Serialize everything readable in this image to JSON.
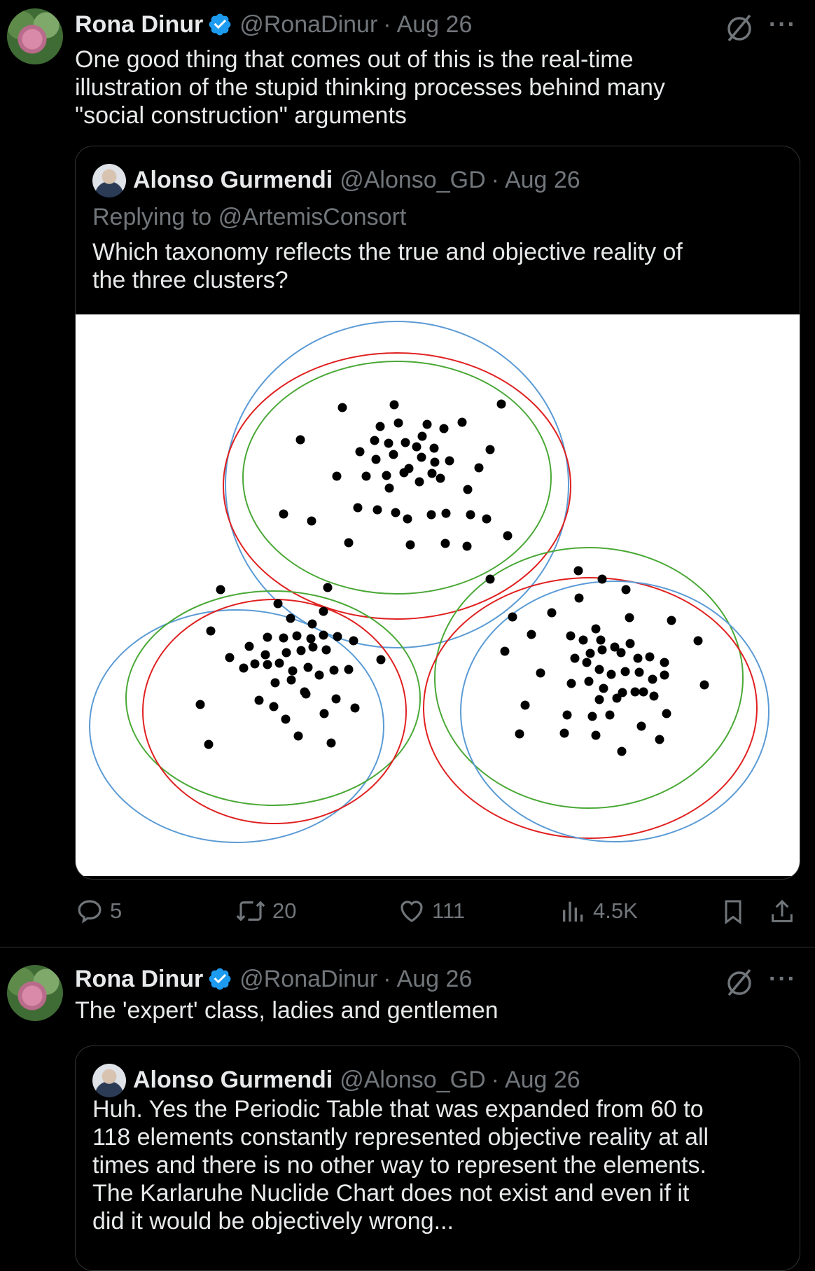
{
  "tweets": [
    {
      "author": "Rona Dinur",
      "handle": "@RonaDinur",
      "time": "Aug 26",
      "text_lines": [
        "One good thing that comes out of this is the real-time",
        "illustration of the stupid thinking processes behind many",
        "\"social construction\" arguments"
      ],
      "quote": {
        "author": "Alonso Gurmendi",
        "handle": "@Alonso_GD",
        "time": "Aug 26",
        "replying_prefix": "Replying to",
        "replying_to": "@ArtemisConsort",
        "text_lines": [
          "Which taxonomy reflects the true and objective reality of",
          "the three clusters?"
        ]
      },
      "actions": {
        "replies": "5",
        "reposts": "20",
        "likes": "111",
        "views": "4.5K"
      }
    },
    {
      "author": "Rona Dinur",
      "handle": "@RonaDinur",
      "time": "Aug 26",
      "text_lines": [
        "The 'expert' class, ladies and gentlemen"
      ],
      "quote": {
        "author": "Alonso Gurmendi",
        "handle": "@Alonso_GD",
        "time": "Aug 26",
        "text_lines": [
          "Huh. Yes the Periodic Table that was expanded from 60 to",
          "118 elements constantly represented objective reality at all",
          "times and there is no other way to represent the elements.",
          "The Karlaruhe Nuclide Chart does not exist and even if it",
          "did it would be objectively wrong..."
        ]
      }
    }
  ],
  "icons": {
    "verified": "verified-badge-icon",
    "grok": "grok-icon",
    "more": "more-icon",
    "reply": "reply-icon",
    "repost": "repost-icon",
    "like": "like-icon",
    "views": "views-icon",
    "bookmark": "bookmark-icon",
    "share": "share-icon"
  },
  "colors": {
    "background": "#000000",
    "text": "#e7e9ea",
    "muted": "#71767b",
    "verified": "#1d9bf0",
    "cluster_blue": "#5b9bd5",
    "cluster_red": "#e02020",
    "cluster_green": "#4aa836"
  }
}
